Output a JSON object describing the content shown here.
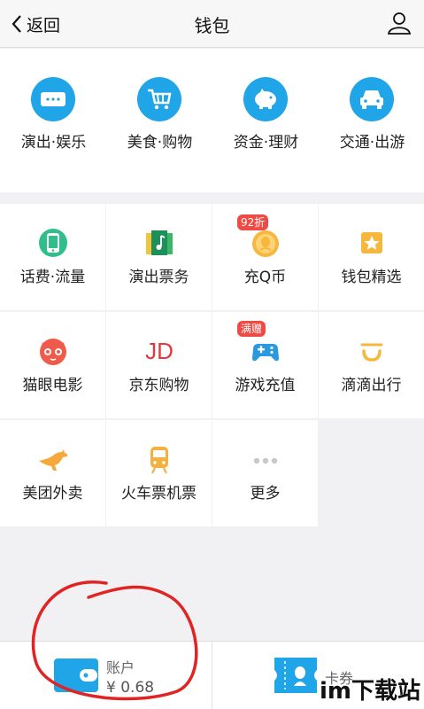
{
  "header": {
    "back_label": "返回",
    "title": "钱包"
  },
  "quick_actions": [
    {
      "label": "演出·娱乐",
      "icon": "ticket-icon"
    },
    {
      "label": "美食·购物",
      "icon": "cart-icon"
    },
    {
      "label": "资金·理财",
      "icon": "piggy-bank-icon"
    },
    {
      "label": "交通·出游",
      "icon": "car-icon"
    }
  ],
  "services": [
    {
      "label": "话费·流量",
      "icon": "phone-icon"
    },
    {
      "label": "演出票务",
      "icon": "ticket-music-icon"
    },
    {
      "label": "充Q币",
      "icon": "qq-coin-icon",
      "badge": "92折"
    },
    {
      "label": "钱包精选",
      "icon": "star-icon"
    },
    {
      "label": "猫眼电影",
      "icon": "cat-eye-icon"
    },
    {
      "label": "京东购物",
      "icon": "jd-icon",
      "icon_text": "JD"
    },
    {
      "label": "游戏充值",
      "icon": "gamepad-icon",
      "badge": "满赠"
    },
    {
      "label": "滴滴出行",
      "icon": "didi-icon"
    },
    {
      "label": "美团外卖",
      "icon": "kangaroo-icon"
    },
    {
      "label": "火车票机票",
      "icon": "train-icon"
    },
    {
      "label": "更多",
      "icon": "more-icon"
    }
  ],
  "account": {
    "label": "账户",
    "balance": "¥ 0.68"
  },
  "cards": {
    "label": "卡券"
  },
  "watermark": "im下载站",
  "colors": {
    "accent": "#1fa5e8",
    "annotation": "#e02424",
    "badge": "#ef4a43"
  }
}
